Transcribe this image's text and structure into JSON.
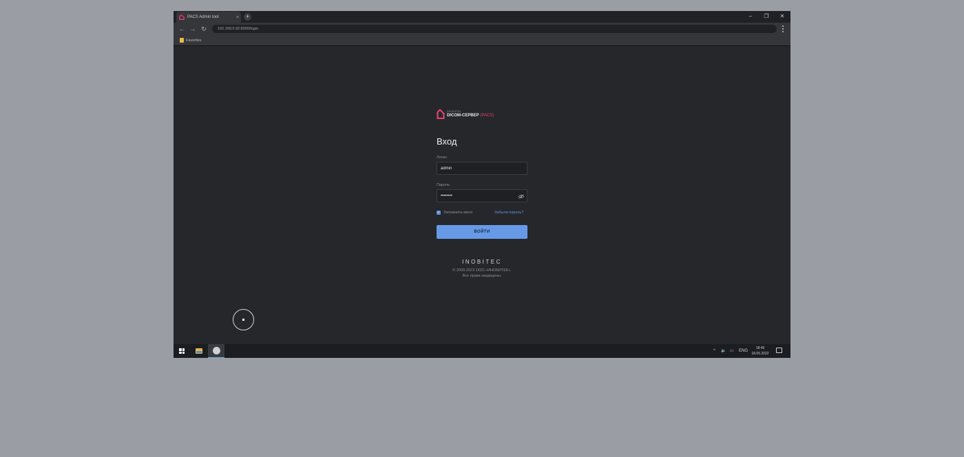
{
  "browser": {
    "tab_title": "PACS Admin tool",
    "tab_close": "×",
    "new_tab": "+",
    "address": "192.168.0.92:8000/login",
    "bookmark_label": "Favorites",
    "minimize": "–",
    "restore": "❐",
    "close": "✕",
    "back": "←",
    "forward": "→",
    "reload": "↻"
  },
  "logo": {
    "small": "ИНОБИТЕК",
    "main": "DICOM-СЕРВЕР",
    "pacs": "(PACS)"
  },
  "form": {
    "heading": "Вход",
    "login_label": "Логин",
    "login_value": "admin",
    "password_label": "Пароль",
    "password_value": "password",
    "remember_label": "Запомнить меня",
    "remember_checked": true,
    "forgot_link": "Забыли пароль?",
    "submit_label": "ВОЙТИ"
  },
  "footer": {
    "brand": "INOBITEC",
    "copyright": "© 2009-2023 ООО «ИНОБИТЕК».",
    "rights": "Все права защищены."
  },
  "taskbar": {
    "chevron": "^",
    "volume": "🔈",
    "network": "▭",
    "lang": "ENG",
    "time": "18:49",
    "date": "18.05.2022"
  },
  "colors": {
    "accent": "#679ae6",
    "brand_pink": "#e0436a",
    "page_bg": "#26272b"
  }
}
